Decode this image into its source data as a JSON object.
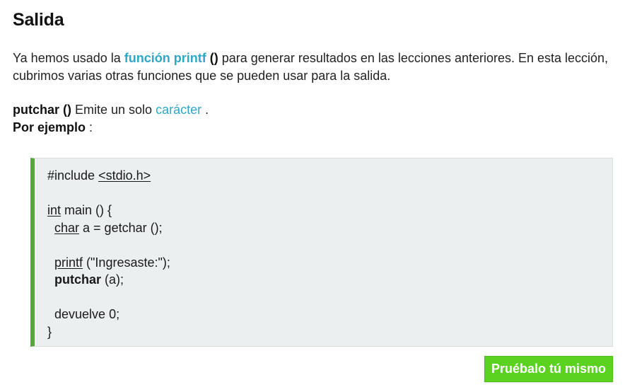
{
  "heading": "Salida",
  "intro": {
    "text_before": "Ya hemos usado la ",
    "link_text": "función printf",
    "parens": " ()",
    "text_after": " para generar resultados en las lecciones anteriores. En esta lección, cubrimos varias otras funciones que se pueden usar para la salida."
  },
  "putchar_line": {
    "term": "putchar ()",
    "text": " Emite un solo ",
    "link_text": "carácter",
    "end": " ."
  },
  "example_line": {
    "label": "Por ejemplo",
    "colon": " :"
  },
  "code": {
    "include_kw": "#include ",
    "include_hdr": "<stdio.h>",
    "int_kw": "int",
    "main_sig": " main () {",
    "char_kw": "char",
    "char_rest": " a = getchar ();",
    "printf_kw": "printf",
    "printf_rest": " (\"Ingresaste:\");",
    "putchar_kw": "putchar",
    "putchar_rest": " (a);",
    "return_stmt": "devuelve 0;",
    "close_brace": "}"
  },
  "try_button": {
    "label": "Pruébalo tú mismo"
  },
  "colors": {
    "link": "#2fa8c7",
    "code_bg": "#ebeff0",
    "code_accent": "#5aa341",
    "button_bg": "#5bd21f"
  }
}
